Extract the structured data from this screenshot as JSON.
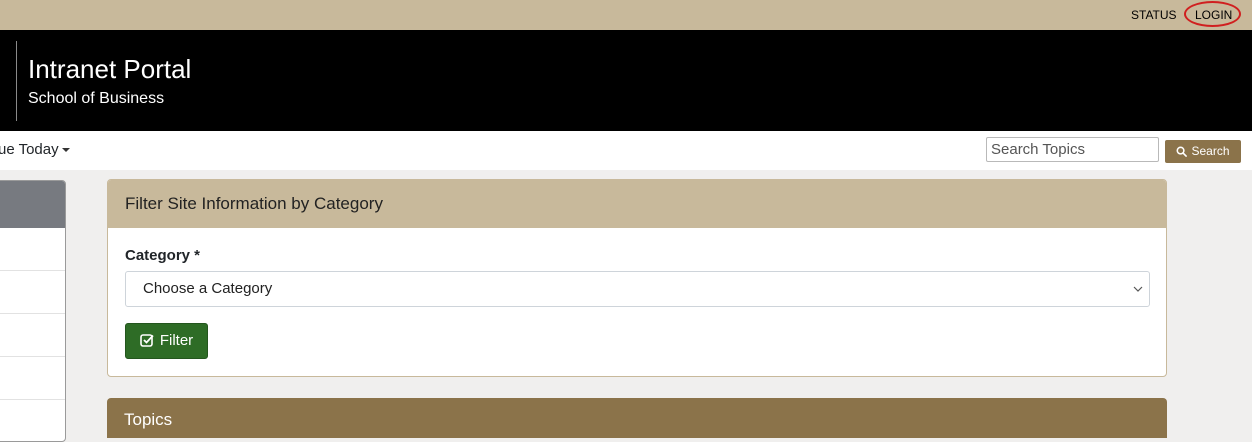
{
  "topbar": {
    "status_label": "STATUS",
    "login_label": "LOGIN"
  },
  "header": {
    "title": "Intranet Portal",
    "subtitle": "School of Business"
  },
  "nav": {
    "item_label": "ue Today"
  },
  "search": {
    "placeholder": "Search Topics",
    "button_label": "Search"
  },
  "filter_panel": {
    "heading": "Filter Site Information by Category",
    "category_label": "Category *",
    "category_selected": "Choose a Category",
    "filter_button_label": "Filter"
  },
  "topics_panel": {
    "heading": "Topics"
  },
  "colors": {
    "topbar_bg": "#c8b99b",
    "header_bg": "#000000",
    "accent_brown": "#8b734a",
    "filter_green": "#2e6c26",
    "login_highlight": "#d01f1f"
  },
  "icons": [
    "search-icon",
    "check-square-icon",
    "chevron-down-icon",
    "caret-down-icon"
  ]
}
